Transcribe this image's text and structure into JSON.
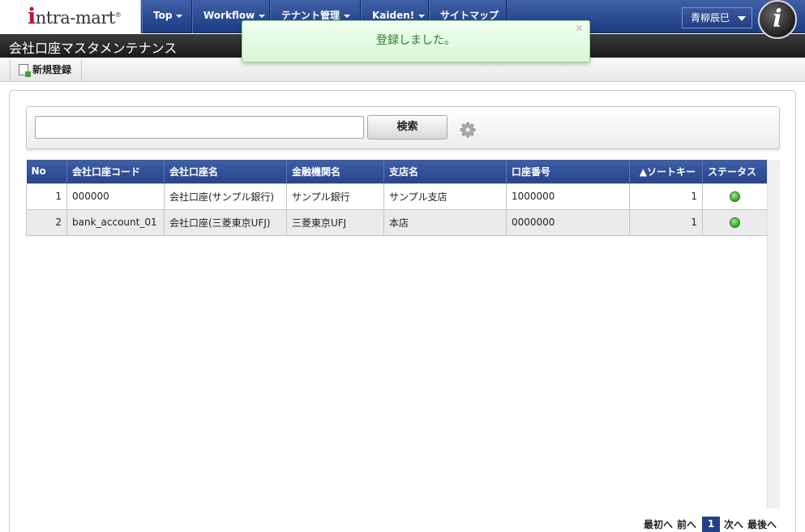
{
  "brand": {
    "logo_text": "ntra-mart",
    "logo_initial": "i",
    "logo_mark": "®"
  },
  "nav": {
    "items": [
      {
        "label": "Top",
        "dropdown": true
      },
      {
        "label": "Workflow",
        "dropdown": true
      },
      {
        "label": "テナント管理",
        "dropdown": true
      },
      {
        "label": "Kaiden!",
        "dropdown": true
      },
      {
        "label": "サイトマップ",
        "dropdown": false
      }
    ],
    "user_name": "青柳辰巳",
    "info_icon_label": "i"
  },
  "page": {
    "title": "会社口座マスタメンテナンス"
  },
  "toolbar": {
    "new_label": "新規登録"
  },
  "search": {
    "value": "",
    "placeholder": "",
    "button_label": "検索"
  },
  "table": {
    "columns": [
      "No",
      "会社口座コード",
      "会社口座名",
      "金融機関名",
      "支店名",
      "口座番号",
      "▲ソートキー",
      "ステータス"
    ],
    "rows": [
      {
        "no": "1",
        "code": "000000",
        "name": "会社口座(サンプル銀行)",
        "bank": "サンプル銀行",
        "branch": "サンプル支店",
        "account": "1000000",
        "sort_key": "1",
        "status": "active"
      },
      {
        "no": "2",
        "code": "bank_account_01",
        "name": "会社口座(三菱東京UFJ)",
        "bank": "三菱東京UFJ",
        "branch": "本店",
        "account": "0000000",
        "sort_key": "1",
        "status": "active"
      }
    ]
  },
  "pager": {
    "first": "最初へ",
    "prev": "前へ",
    "current": "1",
    "next": "次へ",
    "last": "最後へ"
  },
  "toast": {
    "message": "登録しました。",
    "close": "×"
  },
  "colors": {
    "nav_blue": "#2b4a94",
    "status_active": "#26b71a",
    "toast_text": "#2a7d2a"
  }
}
